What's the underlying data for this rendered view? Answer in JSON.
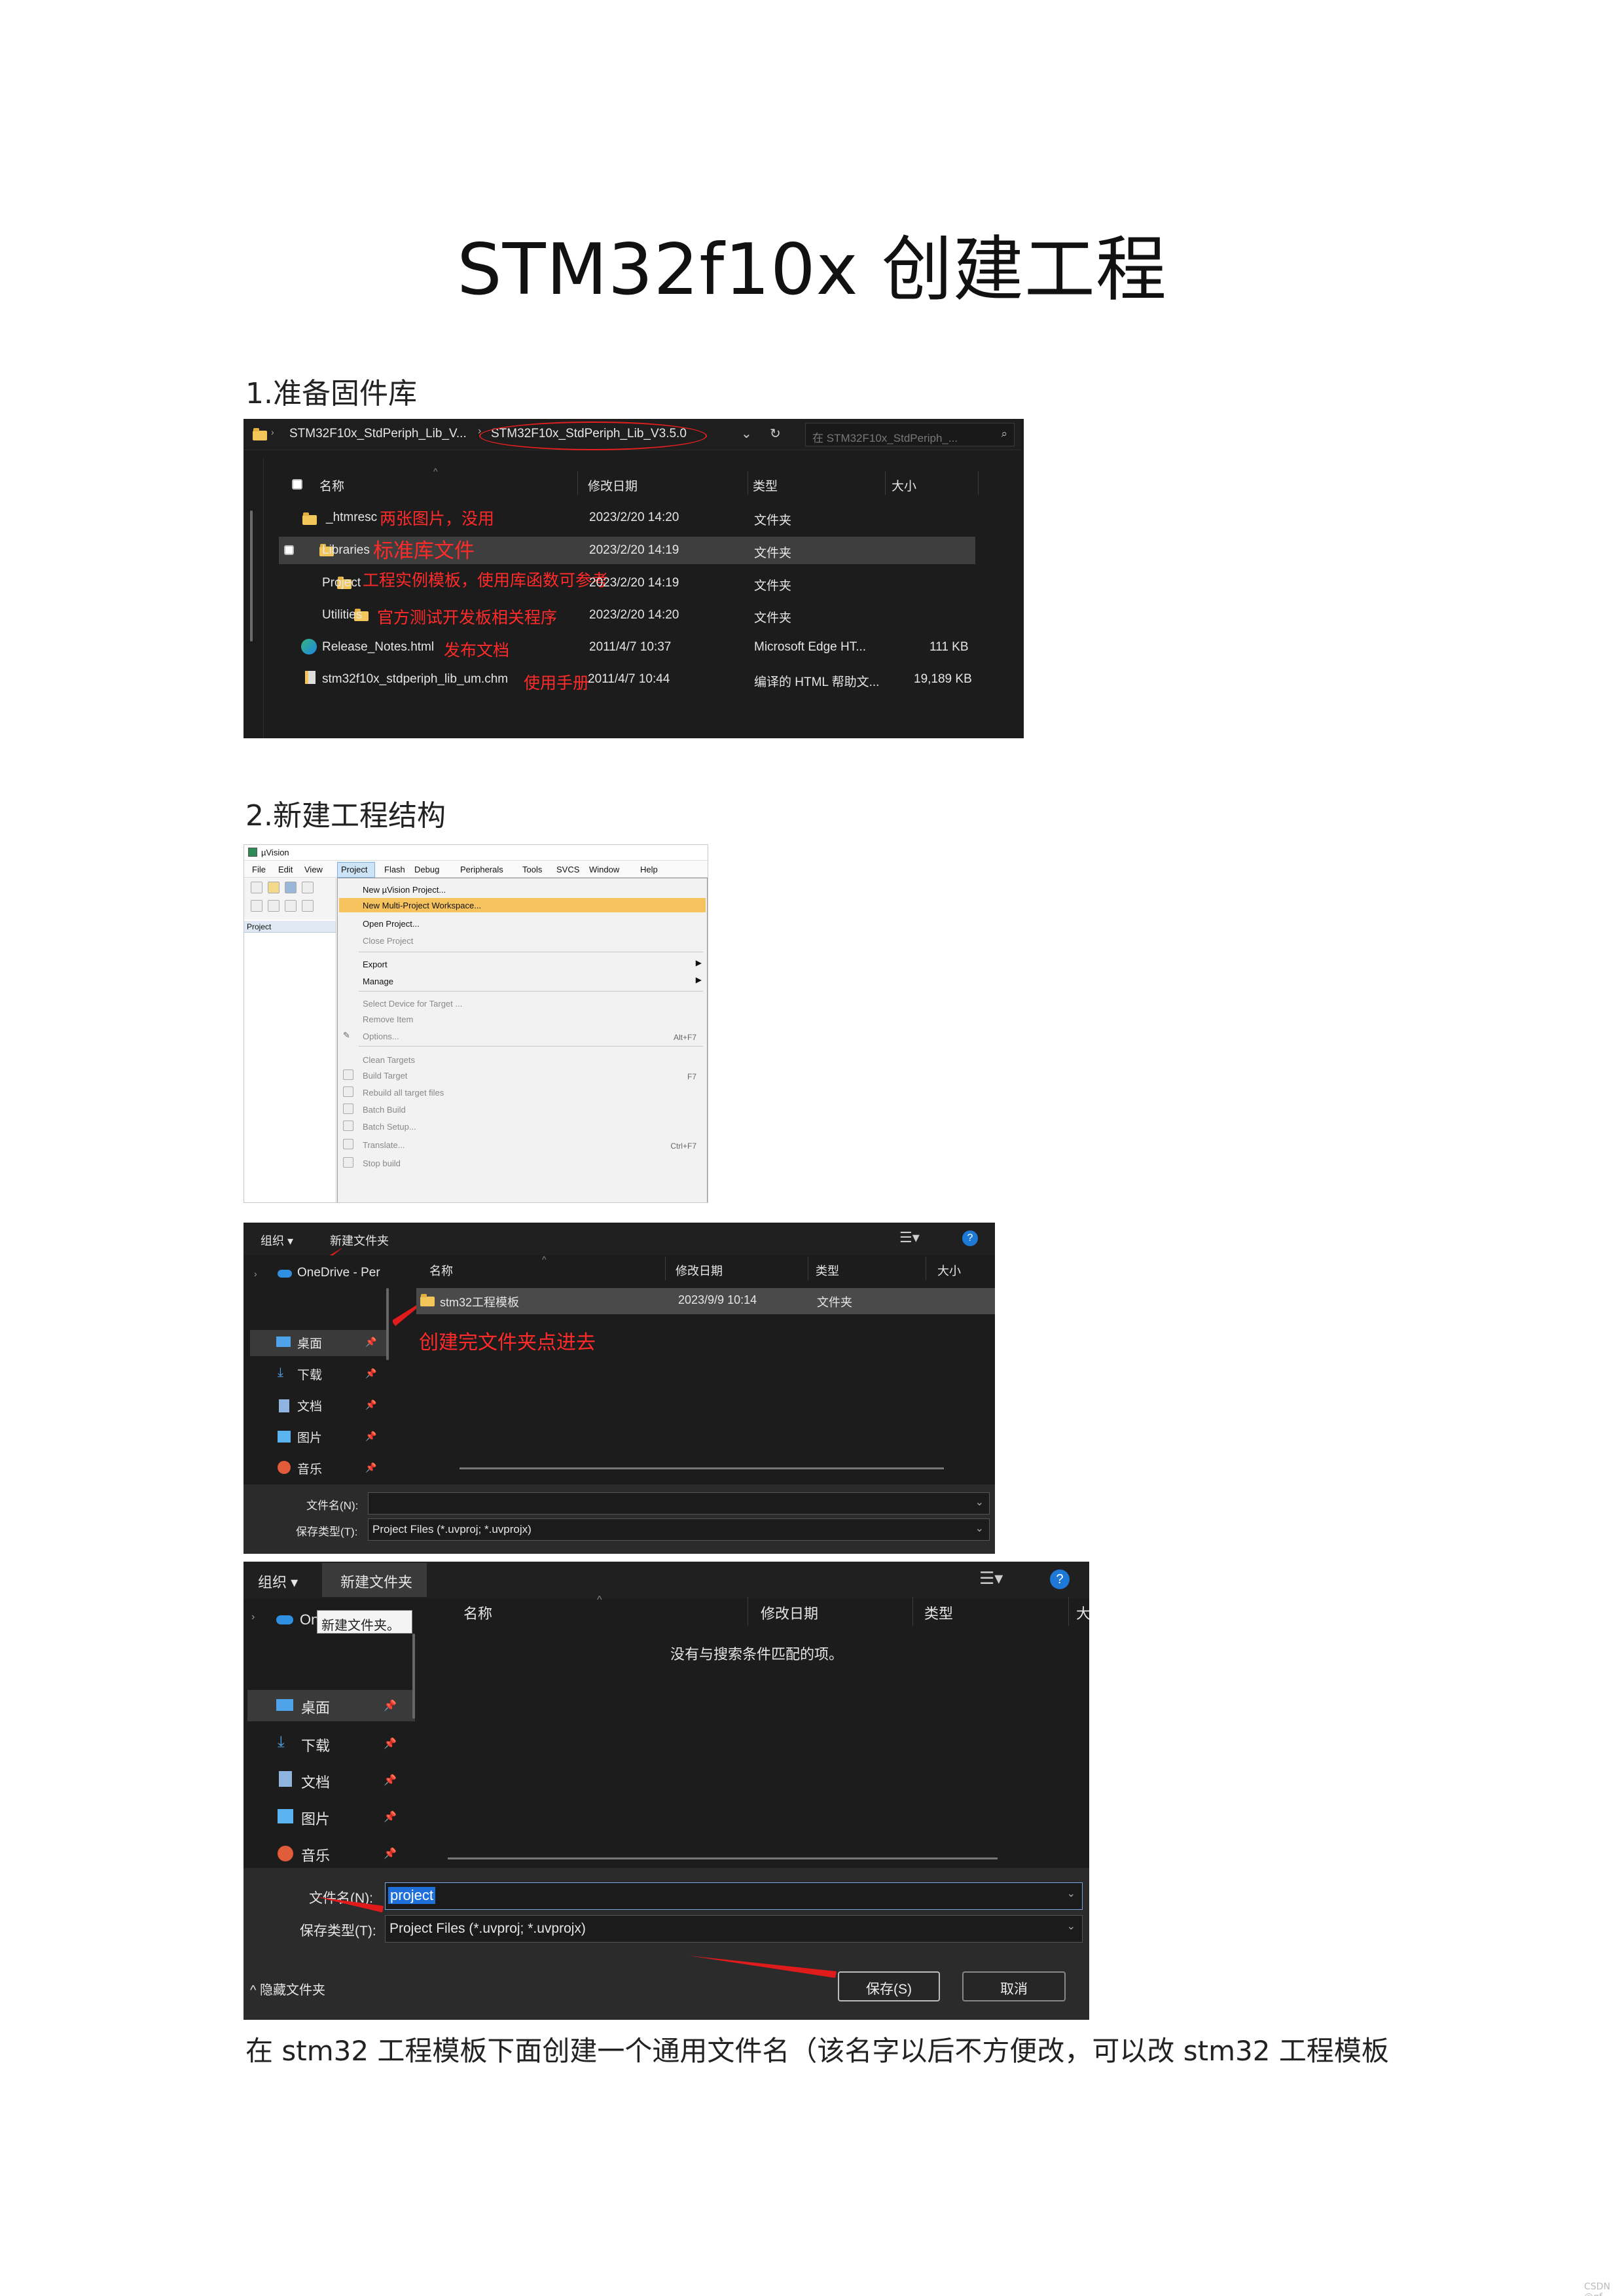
{
  "document": {
    "title": "STM32f10x 创建工程",
    "section1": "1.准备固件库",
    "section2": "2.新建工程结构",
    "paragraph": "在 stm32 工程模板下面创建一个通用文件名（该名字以后不方便改，可以改 stm32 工程模板",
    "watermark": "CSDN @gf"
  },
  "explorer1": {
    "breadcrumb_1": "STM32F10x_StdPeriph_Lib_V...",
    "breadcrumb_sep": "›",
    "breadcrumb_2": "STM32F10x_StdPeriph_Lib_V3.5.0",
    "search_placeholder": "在 STM32F10x_StdPeriph_...",
    "col_name": "名称",
    "col_date": "修改日期",
    "col_type": "类型",
    "col_size": "大小",
    "rows": [
      {
        "name": "_htmresc",
        "note": "两张图片，没用",
        "date": "2023/2/20 14:20",
        "type": "文件夹",
        "size": ""
      },
      {
        "name": "Libraries",
        "note": "标准库文件",
        "date": "2023/2/20 14:19",
        "type": "文件夹",
        "size": ""
      },
      {
        "name": "Project",
        "note": "工程实例模板，使用库函数可参考",
        "date": "2023/2/20 14:19",
        "type": "文件夹",
        "size": ""
      },
      {
        "name": "Utilities",
        "note": "官方测试开发板相关程序",
        "date": "2023/2/20 14:20",
        "type": "文件夹",
        "size": ""
      },
      {
        "name": "Release_Notes.html",
        "note": "发布文档",
        "date": "2011/4/7 10:37",
        "type": "Microsoft Edge HT...",
        "size": "111 KB"
      },
      {
        "name": "stm32f10x_stdperiph_lib_um.chm",
        "note": "使用手册",
        "date": "2011/4/7 10:44",
        "type": "编译的 HTML 帮助文...",
        "size": "19,189 KB"
      }
    ]
  },
  "uvision": {
    "title": "µVision",
    "menubar": [
      "File",
      "Edit",
      "View",
      "Project",
      "Flash",
      "Debug",
      "Peripherals",
      "Tools",
      "SVCS",
      "Window",
      "Help"
    ],
    "panel_label": "Project",
    "menu_items": {
      "new_project": "New µVision Project...",
      "new_multi": "New Multi-Project Workspace...",
      "open_project": "Open Project...",
      "close_project": "Close Project",
      "export": "Export",
      "manage": "Manage",
      "select_device": "Select Device for Target ...",
      "remove_item": "Remove Item",
      "options": "Options...",
      "options_sc": "Alt+F7",
      "clean": "Clean Targets",
      "build": "Build Target",
      "build_sc": "F7",
      "rebuild": "Rebuild all target files",
      "batch_build": "Batch Build",
      "batch_setup": "Batch Setup...",
      "translate": "Translate...",
      "translate_sc": "Ctrl+F7",
      "stop": "Stop build"
    }
  },
  "dialog1": {
    "organize": "组织 ▾",
    "new_folder": "新建文件夹",
    "onedrive": "OneDrive - Per",
    "col_name": "名称",
    "col_date": "修改日期",
    "col_type": "类型",
    "col_size": "大小",
    "folder_name": "stm32工程模板",
    "folder_date": "2023/9/9 10:14",
    "folder_type": "文件夹",
    "note": "创建完文件夹点进去",
    "side": [
      "桌面",
      "下载",
      "文档",
      "图片",
      "音乐"
    ],
    "filename_label": "文件名(N):",
    "filename_value": "",
    "filetype_label": "保存类型(T):",
    "filetype_value": "Project Files (*.uvproj; *.uvprojx)"
  },
  "dialog2": {
    "organize": "组织 ▾",
    "new_folder": "新建文件夹",
    "onedrive": "On",
    "tooltip": "新建文件夹。",
    "col_name": "名称",
    "col_date": "修改日期",
    "col_type": "类型",
    "col_size": "大",
    "empty_text": "没有与搜索条件匹配的项。",
    "side": [
      "桌面",
      "下载",
      "文档",
      "图片",
      "音乐"
    ],
    "filename_label": "文件名(N):",
    "filename_value": "project",
    "filetype_label": "保存类型(T):",
    "filetype_value": "Project Files (*.uvproj; *.uvprojx)",
    "hide_folders": "^ 隐藏文件夹",
    "save": "保存(S)",
    "cancel": "取消"
  },
  "colors": {
    "annotation_red": "#ff2b2b",
    "dark_bg": "#1c1c1c",
    "highlight": "#f5c56b"
  }
}
